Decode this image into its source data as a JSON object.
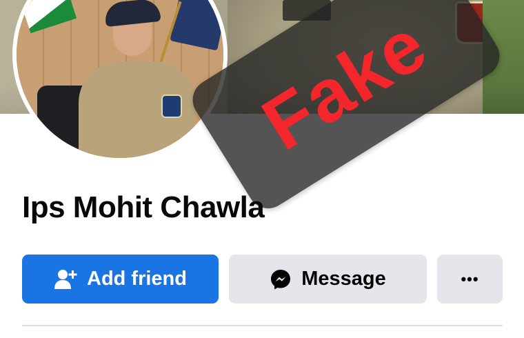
{
  "badge": {
    "text": "Fake",
    "color": "#f3262c"
  },
  "profile": {
    "name": "Ips Mohit Chawla"
  },
  "actions": {
    "add_friend": {
      "label": "Add friend",
      "icon": "add-user-icon",
      "color": "#1b74e4"
    },
    "message": {
      "label": "Message",
      "icon": "messenger-icon"
    },
    "more": {
      "label": "•••",
      "icon": "more-icon"
    }
  }
}
